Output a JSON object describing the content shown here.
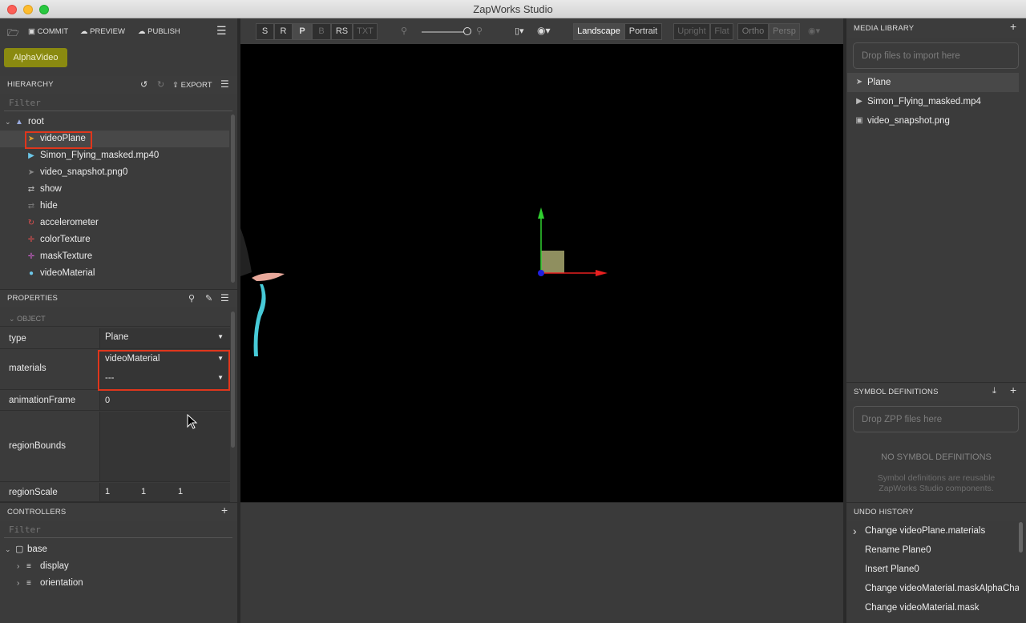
{
  "window": {
    "title": "ZapWorks Studio"
  },
  "toolbar": {
    "commit": "COMMIT",
    "preview": "PREVIEW",
    "publish": "PUBLISH"
  },
  "project_button": "AlphaVideo",
  "hierarchy": {
    "header": "HIERARCHY",
    "export": "EXPORT",
    "filter_placeholder": "Filter",
    "root": "root",
    "items": [
      {
        "label": "videoPlane",
        "icon": "rocket-icon"
      },
      {
        "label": "Simon_Flying_masked.mp40",
        "icon": "video-icon"
      },
      {
        "label": "video_snapshot.png0",
        "icon": "rocket-icon"
      },
      {
        "label": "show",
        "icon": "shuffle-icon"
      },
      {
        "label": "hide",
        "icon": "shuffle-icon"
      },
      {
        "label": "accelerometer",
        "icon": "refresh-icon"
      },
      {
        "label": "colorTexture",
        "icon": "move-icon"
      },
      {
        "label": "maskTexture",
        "icon": "move-icon"
      },
      {
        "label": "videoMaterial",
        "icon": "droplet-icon"
      }
    ]
  },
  "properties": {
    "header": "PROPERTIES",
    "section": "OBJECT",
    "rows": {
      "type": {
        "key": "type",
        "value": "Plane"
      },
      "materials": {
        "key": "materials",
        "value1": "videoMaterial",
        "value2": "---"
      },
      "animationFrame": {
        "key": "animationFrame",
        "value": "0"
      },
      "regionBounds": {
        "key": "regionBounds"
      },
      "regionScale": {
        "key": "regionScale",
        "v1": "1",
        "v2": "1",
        "v3": "1"
      }
    }
  },
  "controllers": {
    "header": "CONTROLLERS",
    "filter_placeholder": "Filter",
    "items": [
      {
        "label": "base"
      },
      {
        "label": "display"
      },
      {
        "label": "orientation"
      }
    ]
  },
  "viewport_toolbar": {
    "modes": [
      "S",
      "R",
      "P",
      "B",
      "RS",
      "TXT"
    ],
    "orientation": [
      "Landscape",
      "Portrait"
    ],
    "view": [
      "Upright",
      "Flat"
    ],
    "projection": [
      "Ortho",
      "Persp"
    ]
  },
  "media_library": {
    "header": "MEDIA LIBRARY",
    "drop_text": "Drop files to import here",
    "items": [
      {
        "label": "Plane",
        "icon": "rocket-icon"
      },
      {
        "label": "Simon_Flying_masked.mp4",
        "icon": "video-icon"
      },
      {
        "label": "video_snapshot.png",
        "icon": "image-icon"
      }
    ]
  },
  "symbol_definitions": {
    "header": "SYMBOL DEFINITIONS",
    "drop_text": "Drop ZPP files here",
    "empty_title": "NO SYMBOL DEFINITIONS",
    "empty_line1": "Symbol definitions are reusable",
    "empty_line2": "ZapWorks Studio components."
  },
  "undo_history": {
    "header": "UNDO HISTORY",
    "items": [
      "Change videoPlane.materials",
      "Rename Plane0",
      "Insert Plane0",
      "Change videoMaterial.maskAlphaChannel",
      "Change videoMaterial.mask"
    ]
  },
  "colors": {
    "highlight": "#e0361c",
    "project_button": "#8a8a10",
    "gizmo_x": "#e82020",
    "gizmo_y": "#30d030",
    "gizmo_z": "#2020e0"
  }
}
